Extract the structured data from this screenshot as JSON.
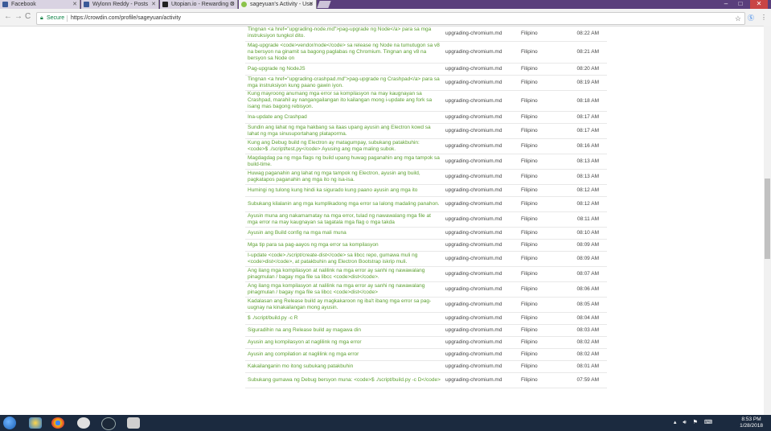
{
  "browser": {
    "tabs": [
      {
        "title": "Facebook",
        "icon": "facebook-icon",
        "color": "#3b5998",
        "active": false
      },
      {
        "title": "Wylonn Reddy - Posts",
        "icon": "facebook-icon",
        "color": "#3b5998",
        "active": false
      },
      {
        "title": "Utopian.io - Rewarding O",
        "icon": "utopian-icon",
        "color": "#222222",
        "active": false
      },
      {
        "title": "sageyuan's Activity - Uso",
        "icon": "crowdin-icon",
        "color": "#8bc34a",
        "active": true
      }
    ],
    "secure_label": "Secure",
    "url": "https://crowdin.com/profile/sageyuan/activity"
  },
  "activity": {
    "rows": [
      {
        "text": "Tingnan <a href=\"upgrading-node.md\">pag-upgrade ng Node</a> para sa mga instruksiyon tungkol dito.",
        "file": "upgrading-chromium.md",
        "lang": "Filipino",
        "time": "08:22 AM"
      },
      {
        "text": "Mag-upgrade <code>vendor/node</code> sa release ng Node na tumutugon sa v8 na bersyon na ginamit sa bagong paglabas ng Chromium. Tingnan ang v8 na bersyon sa Node on",
        "file": "upgrading-chromium.md",
        "lang": "Filipino",
        "time": "08:21 AM"
      },
      {
        "text": "Pag-upgrade ng NodeJS",
        "file": "upgrading-chromium.md",
        "lang": "Filipino",
        "time": "08:20 AM"
      },
      {
        "text": "Tingnan <a href=\"upgrading-crashpad.md\">pag-upgrade ng Crashpad</a> para sa mga instruksiyon kung paano gawin iyon.",
        "file": "upgrading-chromium.md",
        "lang": "Filipino",
        "time": "08:19 AM"
      },
      {
        "text": "Kung mayroong anumang mga error sa kompilasyon na may kaugnayan sa Crashpad, marahil ay nangangailangan ito kailangan mong i-update ang fork sa isang mas bagong rebisyon.",
        "file": "upgrading-chromium.md",
        "lang": "Filipino",
        "time": "08:18 AM"
      },
      {
        "text": "Ina-update ang Crashpad",
        "file": "upgrading-chromium.md",
        "lang": "Filipino",
        "time": "08:17 AM"
      },
      {
        "text": "Sundin ang lahat ng mga hakbang sa itaas upang ayusin ang Electron kowd sa lahat ng mga sinusuportahang plataporma.",
        "file": "upgrading-chromium.md",
        "lang": "Filipino",
        "time": "08:17 AM"
      },
      {
        "text": "Kung ang Debug build ng Electron ay matagumpay, subukang patakbuhin: <code>$ ./script/test.py</code> Ayusing ang mga maling subok.",
        "file": "upgrading-chromium.md",
        "lang": "Filipino",
        "time": "08:16 AM"
      },
      {
        "text": "Magdagdag pa ng mga flags ng build upang huwag paganahin ang mga tampok sa build-time.",
        "file": "upgrading-chromium.md",
        "lang": "Filipino",
        "time": "08:13 AM"
      },
      {
        "text": "Huwag paganahin ang lahat ng mga tampok ng Electron, ayusin ang build, pagkatapos paganahin ang mga ito ng isa-isa.",
        "file": "upgrading-chromium.md",
        "lang": "Filipino",
        "time": "08:13 AM"
      },
      {
        "text": "Humingi ng tulong kung hindi ka sigurado kung paano ayusin ang mga ito",
        "file": "upgrading-chromium.md",
        "lang": "Filipino",
        "time": "08:12 AM"
      },
      {
        "text": "Subukang kilalanin ang mga kumplikadong mga error sa lalong madaling panahon.",
        "file": "upgrading-chromium.md",
        "lang": "Filipino",
        "time": "08:12 AM"
      },
      {
        "text": "Ayusin muna ang nakamamatay na mga error, tulad ng nawawalang mga file at mga error na may kaugnayan sa tagatala mga flag o mga takda",
        "file": "upgrading-chromium.md",
        "lang": "Filipino",
        "time": "08:11 AM"
      },
      {
        "text": "Ayusin ang Build config na mga mali muna",
        "file": "upgrading-chromium.md",
        "lang": "Filipino",
        "time": "08:10 AM"
      },
      {
        "text": "Mga tip para sa pag-aayos ng mga error sa kompilasyon",
        "file": "upgrading-chromium.md",
        "lang": "Filipino",
        "time": "08:09 AM"
      },
      {
        "text": "I-update <code>./script/create-dist</code> sa libcc repo, gumawa muli ng <code>dist</code>, at patakbuhin ang Electron Bootstrap iskrip muli.",
        "file": "upgrading-chromium.md",
        "lang": "Filipino",
        "time": "08:09 AM"
      },
      {
        "text": "Ang ilang mga kompilasyon at nalilink na mga error ay sanhi ng nawawalang pinagmulan / bagay mga file sa libcc <code>dist</code>.",
        "file": "upgrading-chromium.md",
        "lang": "Filipino",
        "time": "08:07 AM"
      },
      {
        "text": "Ang ilang mga kompilasyon at nalilink na mga error ay sanhi ng nawawalang pinagmulan / bagay mga file sa libcc <code>dist</code>",
        "file": "upgrading-chromium.md",
        "lang": "Filipino",
        "time": "08:06 AM"
      },
      {
        "text": "Kadalasan ang Release build ay magkakaroon ng iba't ibang mga error sa pag-uugnay na kinakailangan mong ayusin.",
        "file": "upgrading-chromium.md",
        "lang": "Filipino",
        "time": "08:05 AM"
      },
      {
        "text": "$ ./script/build.py -c R",
        "file": "upgrading-chromium.md",
        "lang": "Filipino",
        "time": "08:04 AM"
      },
      {
        "text": "Siguradihin na ang Release build ay magawa din",
        "file": "upgrading-chromium.md",
        "lang": "Filipino",
        "time": "08:03 AM"
      },
      {
        "text": "Ayusin ang kompilasyon at naglilink ng mga error",
        "file": "upgrading-chromium.md",
        "lang": "Filipino",
        "time": "08:02 AM"
      },
      {
        "text": "Ayusin ang compilation at naglilink ng mga error",
        "file": "upgrading-chromium.md",
        "lang": "Filipino",
        "time": "08:02 AM"
      },
      {
        "text": "Kakailanganin mo itong subukang patakbuhin",
        "file": "upgrading-chromium.md",
        "lang": "Filipino",
        "time": "08:01 AM"
      },
      {
        "text": "Subukang gumawa ng Debug bersyon muna: <code>$ ./script/build.py -c D</code>",
        "file": "upgrading-chromium.md",
        "lang": "Filipino",
        "time": "07:59 AM"
      }
    ]
  },
  "taskbar": {
    "clock_time": "8:53 PM",
    "clock_date": "1/28/2018"
  }
}
